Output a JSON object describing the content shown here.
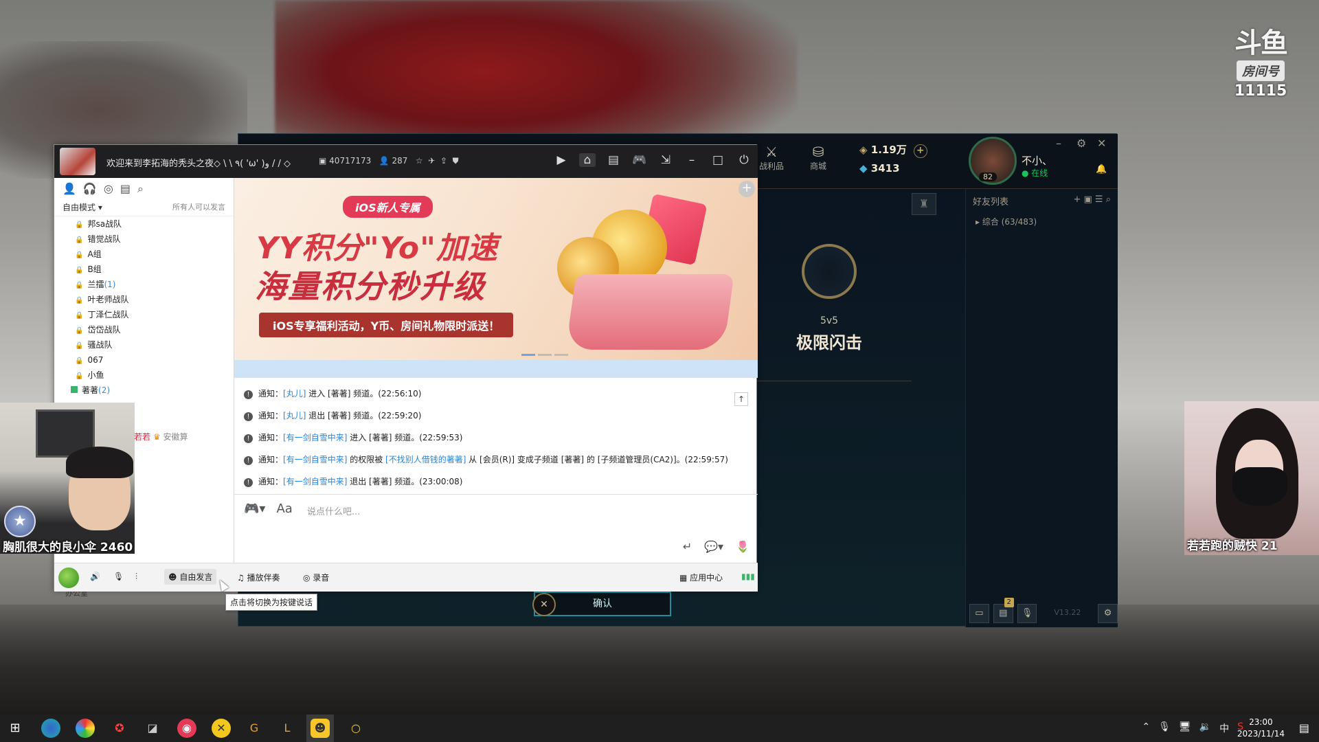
{
  "watermark": {
    "logo": "斗鱼",
    "tag": "房间号",
    "room": "11115"
  },
  "lol": {
    "nav": [
      {
        "icon": "trophy-loot-icon",
        "label": "战利品"
      },
      {
        "icon": "coins-store-icon",
        "label": "商城"
      }
    ],
    "rp": "1.19万",
    "be": "3413",
    "level": "82",
    "summoner_name": "不小、",
    "status": "在线",
    "friends_title": "好友列表",
    "friends_group": "综合 (63/483)",
    "mode_type": "5v5",
    "mode_name": "极限闪击",
    "confirm_label": "确认",
    "notif_count": "2",
    "version": "V13.22"
  },
  "yy": {
    "channel_title": "欢迎来到李拓海的秃头之夜◇ \\ \\ ٩( 'ω' )و / / ◇",
    "channel_id": "40717173",
    "online_count": "287",
    "mode_label": "自由模式",
    "mode_note": "所有人可以发言",
    "channels": [
      {
        "name": "邦sa战队",
        "count": ""
      },
      {
        "name": "错觉战队",
        "count": ""
      },
      {
        "name": "A组",
        "count": ""
      },
      {
        "name": "B组",
        "count": ""
      },
      {
        "name": "兰擂",
        "count": "(1)"
      },
      {
        "name": "叶老师战队",
        "count": ""
      },
      {
        "name": "丁泽仁战队",
        "count": ""
      },
      {
        "name": "岱岱战队",
        "count": ""
      },
      {
        "name": "骚战队",
        "count": ""
      },
      {
        "name": "067",
        "count": ""
      },
      {
        "name": "小鱼",
        "count": ""
      }
    ],
    "active_channel": {
      "name": "著著",
      "count": "(2)"
    },
    "member_name": "人借钱的若若",
    "member_rest": "安徽算",
    "office_label": "办公室",
    "banner": {
      "tag": "iOS新人专属",
      "headline1": "YY积分\"Yo\"加速",
      "headline2": "海量积分秒升级",
      "sub": "iOS专享福利活动，Y币、房间礼物限时派送！"
    },
    "messages": [
      {
        "prefix": "通知：",
        "user": "[丸儿]",
        "rest": " 进入 [著著] 频道。(22:56:10)"
      },
      {
        "prefix": "通知：",
        "user": "[丸儿]",
        "rest": " 退出 [著著] 频道。(22:59:20)"
      },
      {
        "prefix": "通知：",
        "user": "[有一剑自雪中来]",
        "rest": " 进入 [著著] 频道。(22:59:53)"
      },
      {
        "prefix": "通知：",
        "user": "[有一剑自雪中来]",
        "rest": " 的权限被 ",
        "user2": "[不找别人借钱的著著]",
        "rest2": " 从 [会员(R)] 变成子频道 [著著] 的 [子频道管理员(CA2)]。(22:59:57)"
      },
      {
        "prefix": "通知：",
        "user": "[有一剑自雪中来]",
        "rest": " 退出 [著著] 频道。(23:00:08)"
      }
    ],
    "input_placeholder": "说点什么吧...",
    "bottom": {
      "free_speak": "自由发言",
      "play_music": "播放伴奏",
      "record": "录音",
      "app_center": "应用中心"
    },
    "tooltip": "点击将切换为按键说话"
  },
  "cams": {
    "left_label": "胸肌很大的良小伞   2460",
    "right_label": "若若跑的贼快   21"
  },
  "taskbar": {
    "ime": "中",
    "time": "23:00",
    "date": "2023/11/14"
  }
}
